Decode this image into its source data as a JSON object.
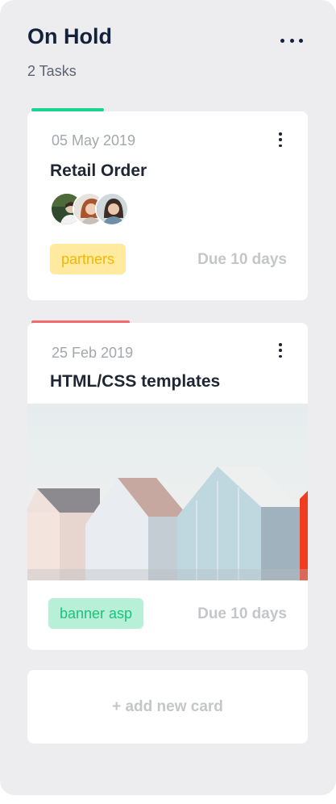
{
  "column": {
    "title": "On Hold",
    "count_label": "2 Tasks",
    "menu_icon": "more-horizontal-icon"
  },
  "cards": [
    {
      "date": "05 May 2019",
      "title": "Retail Order",
      "accent_color": "#1dd391",
      "tag": {
        "label": "partners",
        "bg": "#ffeaa0",
        "color": "#f2b705"
      },
      "due": "Due 10 days",
      "avatars": [
        "member-avatar",
        "member-avatar",
        "member-avatar"
      ]
    },
    {
      "date": "25 Feb 2019",
      "title": "HTML/CSS templates",
      "accent_color": "#f26b6b",
      "tag": {
        "label": "banner asp",
        "bg": "#b7f0d6",
        "color": "#1cc27e"
      },
      "due": "Due 10 days",
      "image": "beach-huts-photo"
    }
  ],
  "add_card_label": "+ add new card"
}
